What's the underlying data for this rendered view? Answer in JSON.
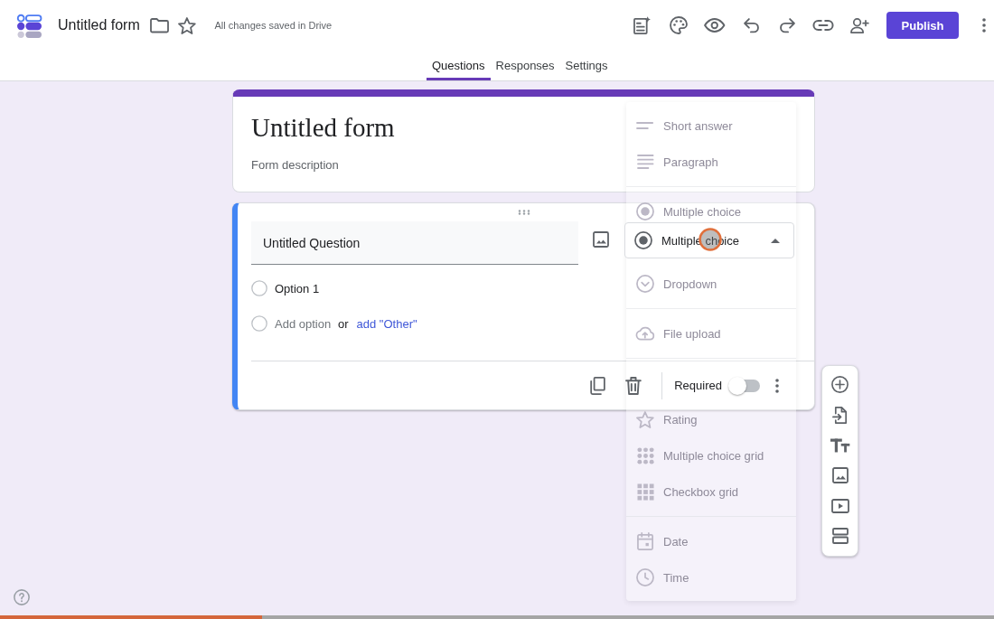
{
  "header": {
    "title": "Untitled form",
    "save_status": "All changes saved in Drive",
    "publish": "Publish"
  },
  "tabs": [
    {
      "label": "Questions",
      "selected": true
    },
    {
      "label": "Responses",
      "selected": false
    },
    {
      "label": "Settings",
      "selected": false
    }
  ],
  "form_header": {
    "title": "Untitled form",
    "placeholder": "Form description"
  },
  "question": {
    "title": "Untitled Question",
    "type": "Multiple choice",
    "options": [
      {
        "label": "Option 1"
      }
    ],
    "add_option": {
      "placeholder": "Add option",
      "or": "or",
      "other_link": "add \"Other\""
    },
    "required": {
      "label": "Required",
      "on": false
    }
  },
  "type_menu": {
    "groups": [
      {
        "items": [
          {
            "kind": "short-answer",
            "label": "Short answer"
          },
          {
            "kind": "paragraph",
            "label": "Paragraph"
          }
        ]
      },
      {
        "items": [
          {
            "kind": "radio",
            "label": "Multiple choice"
          },
          {
            "kind": "dropdown",
            "label": "Dropdown"
          }
        ]
      },
      {
        "items": [
          {
            "kind": "upload",
            "label": "File upload"
          }
        ]
      },
      {
        "items": [
          {
            "kind": "star",
            "label": "Rating"
          },
          {
            "kind": "dot-grid",
            "label": "Multiple choice grid"
          },
          {
            "kind": "square-grid",
            "label": "Checkbox grid"
          }
        ]
      },
      {
        "items": [
          {
            "kind": "calendar",
            "label": "Date"
          },
          {
            "kind": "clock",
            "label": "Time"
          }
        ]
      }
    ]
  },
  "video_progress": {
    "level": 0.264
  }
}
